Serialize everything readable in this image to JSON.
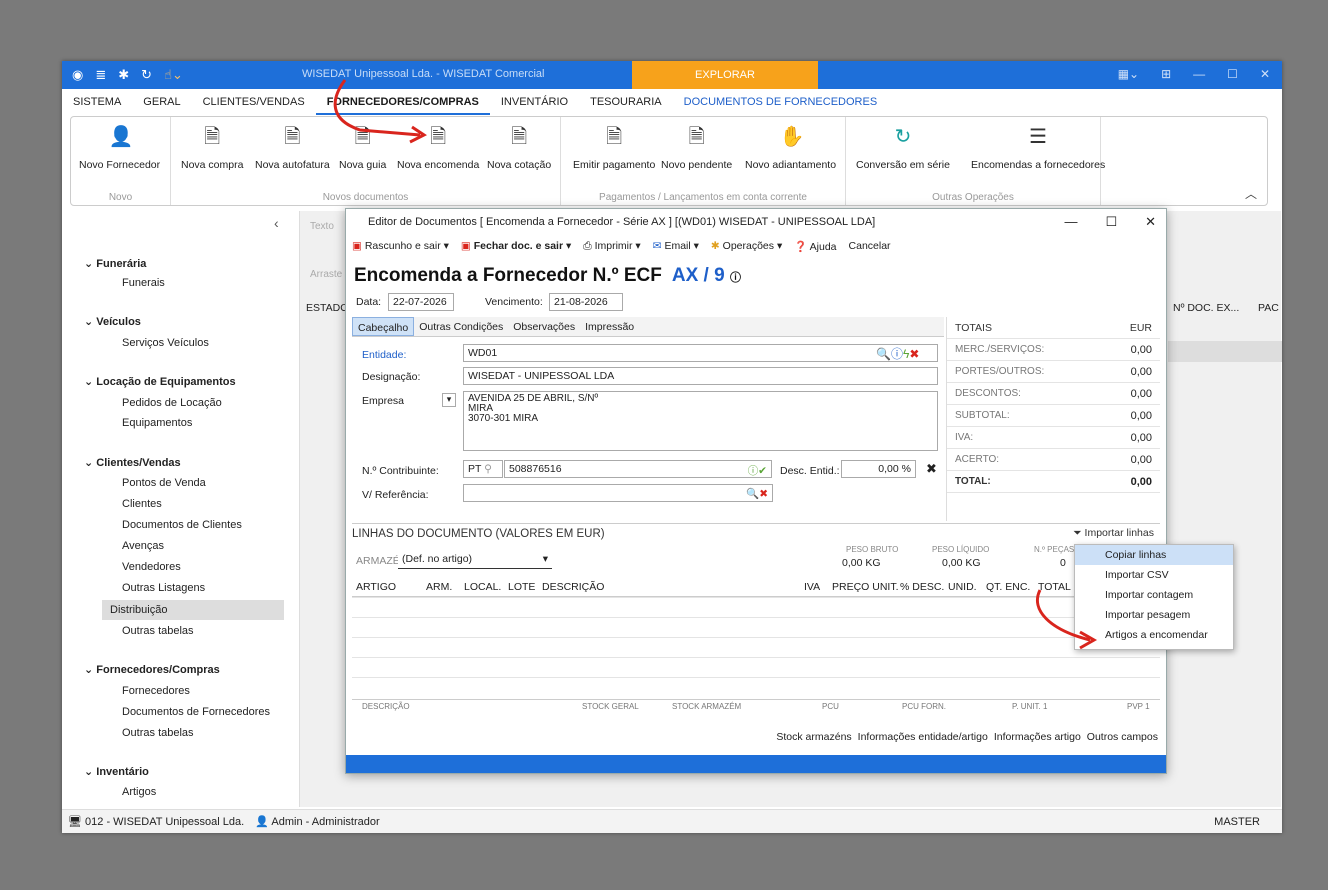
{
  "titlebar": {
    "title": "WISEDAT Unipessoal Lda. - WISEDAT Comercial",
    "explorar": "EXPLORAR"
  },
  "menu": [
    "SISTEMA",
    "GERAL",
    "CLIENTES/VENDAS",
    "FORNECEDORES/COMPRAS",
    "INVENTÁRIO",
    "TESOURARIA",
    "DOCUMENTOS DE FORNECEDORES"
  ],
  "ribbon": {
    "novo": {
      "btn": "Novo Fornecedor",
      "label": "Novo"
    },
    "novos_docs": {
      "label": "Novos documentos",
      "btns": [
        "Nova compra",
        "Nova autofatura",
        "Nova guia",
        "Nova encomenda",
        "Nova cotação"
      ]
    },
    "pagamentos": {
      "label": "Pagamentos / Lançamentos em conta corrente",
      "btns": [
        "Emitir pagamento",
        "Novo pendente",
        "Novo adiantamento"
      ]
    },
    "outras": {
      "label": "Outras Operações",
      "btns": [
        "Conversão em série",
        "Encomendas a fornecedores"
      ]
    }
  },
  "sidebar": {
    "sections": [
      {
        "title": "Funerária",
        "items": [
          "Funerais"
        ]
      },
      {
        "title": "Veículos",
        "items": [
          "Serviços Veículos"
        ]
      },
      {
        "title": "Locação de Equipamentos",
        "items": [
          "Pedidos de Locação",
          "Equipamentos"
        ]
      },
      {
        "title": "Clientes/Vendas",
        "items": [
          "Pontos de Venda",
          "Clientes",
          "Documentos de Clientes",
          "Avenças",
          "Vendedores",
          "Outras Listagens",
          "Distribuição",
          "Outras tabelas"
        ]
      },
      {
        "title": "Fornecedores/Compras",
        "items": [
          "Fornecedores",
          "Documentos de Fornecedores",
          "Outras tabelas"
        ]
      },
      {
        "title": "Inventário",
        "items": [
          "Artigos"
        ]
      }
    ]
  },
  "background_grid": {
    "search_placeholder": "Texto",
    "drag_hint": "Arraste",
    "col_estado": "ESTADO",
    "col_ndoc": "Nº DOC. EX...",
    "col_pa": "PAC"
  },
  "editor": {
    "title": "Editor de Documentos [ Encomenda a Fornecedor - Série AX ] [(WD01) WISEDAT - UNIPESSOAL LDA]",
    "toolbar": [
      "Rascunho e sair",
      "Fechar doc. e sair",
      "Imprimir",
      "Email",
      "Operações",
      "Ajuda",
      "Cancelar"
    ],
    "heading": "Encomenda a Fornecedor N.º ECF",
    "series": "AX / 9",
    "data_label": "Data:",
    "data": "22-07-2026",
    "venc_label": "Vencimento:",
    "venc": "21-08-2026",
    "tabs": [
      "Cabeçalho",
      "Outras Condições",
      "Observações",
      "Impressão"
    ],
    "entidade_label": "Entidade:",
    "entidade": "WD01",
    "designacao_label": "Designação:",
    "designacao": "WISEDAT - UNIPESSOAL LDA",
    "empresa_label": "Empresa",
    "morada1": "AVENIDA 25 DE ABRIL, S/Nº",
    "morada2": "MIRA",
    "morada3": "3070-301 MIRA",
    "contrib_label": "N.º Contribuinte:",
    "pais": "PT",
    "nif": "508876516",
    "desc_label": "Desc. Entid.:",
    "desc": "0,00 %",
    "ref_label": "V/ Referência:",
    "totals_title": "TOTAIS",
    "totals_cur": "EUR",
    "totals": [
      [
        "MERC./SERVIÇOS:",
        "0,00"
      ],
      [
        "PORTES/OUTROS:",
        "0,00"
      ],
      [
        "DESCONTOS:",
        "0,00"
      ],
      [
        "SUBTOTAL:",
        "0,00"
      ],
      [
        "IVA:",
        "0,00"
      ],
      [
        "ACERTO:",
        "0,00"
      ],
      [
        "TOTAL:",
        "0,00"
      ]
    ],
    "lines_title": "LINHAS DO DOCUMENTO (VALORES EM EUR)",
    "importar": "Importar linhas",
    "armazem_label": "ARMAZÉM:",
    "armazem": "(Def. no artigo)",
    "peso_bruto_label": "PESO BRUTO",
    "peso_bruto": "0,00 KG",
    "peso_liq_label": "PESO LÍQUIDO",
    "peso_liq": "0,00 KG",
    "pecas_label": "N.º PEÇAS",
    "pecas": "0",
    "columns": [
      "ARTIGO",
      "ARM.",
      "LOCAL.",
      "LOTE",
      "DESCRIÇÃO",
      "IVA",
      "PREÇO UNIT.",
      "% DESC.",
      "UNID.",
      "QT. ENC.",
      "TOTAL"
    ],
    "info": [
      "DESCRIÇÃO",
      "STOCK GERAL",
      "STOCK ARMAZÉM",
      "PCU",
      "PCU FORN.",
      "P. UNIT. 1",
      "PVP 1"
    ],
    "links": [
      "Stock armazéns",
      "Informações entidade/artigo",
      "Informações artigo",
      "Outros campos"
    ]
  },
  "popup": [
    "Copiar linhas",
    "Importar CSV",
    "Importar contagem",
    "Importar pesagem",
    "Artigos a encomendar"
  ],
  "status": {
    "company": "012 - WISEDAT Unipessoal Lda.",
    "user": "Admin - Administrador",
    "db": "MASTER"
  },
  "colors": {
    "accent": "#1e6fd9",
    "orange": "#f7a21b",
    "red": "#d9251d"
  }
}
